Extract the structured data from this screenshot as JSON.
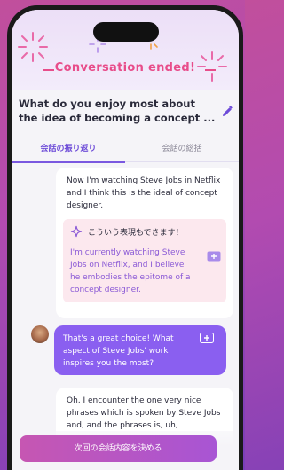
{
  "banner": {
    "title": "Conversation ended!"
  },
  "topic": {
    "text": "What do you enjoy most about the idea of becoming a concept ..."
  },
  "tabs": [
    {
      "label": "会話の振り返り",
      "active": true
    },
    {
      "label": "会話の総括",
      "active": false
    }
  ],
  "messages": {
    "user1": "Now I'm watching Steve Jobs in Netflix and I think this is the ideal of concept designer.",
    "suggestion_heading": "こういう表現もできます！",
    "suggestion": "I'm currently watching Steve Jobs on Netflix, and I believe he embodies the epitome of a concept designer.",
    "ai1": "That's a great choice! What aspect of Steve Jobs' work inspires you the most?",
    "user2": "Oh, I encounter the one very nice phrases which is spoken by Steve Jobs and, and the phrases is, uh,"
  },
  "cta": {
    "label": "次回の会話内容を決める"
  },
  "colors": {
    "accent": "#7a58e0",
    "banner_text": "#e84d8a",
    "ai_bubble": "#8a5ff0",
    "suggestion_bg": "#fce8ee"
  },
  "icons": [
    "firework-icon",
    "edit-pencil-icon",
    "sparkle-icon",
    "add-phrase-icon",
    "avatar"
  ]
}
